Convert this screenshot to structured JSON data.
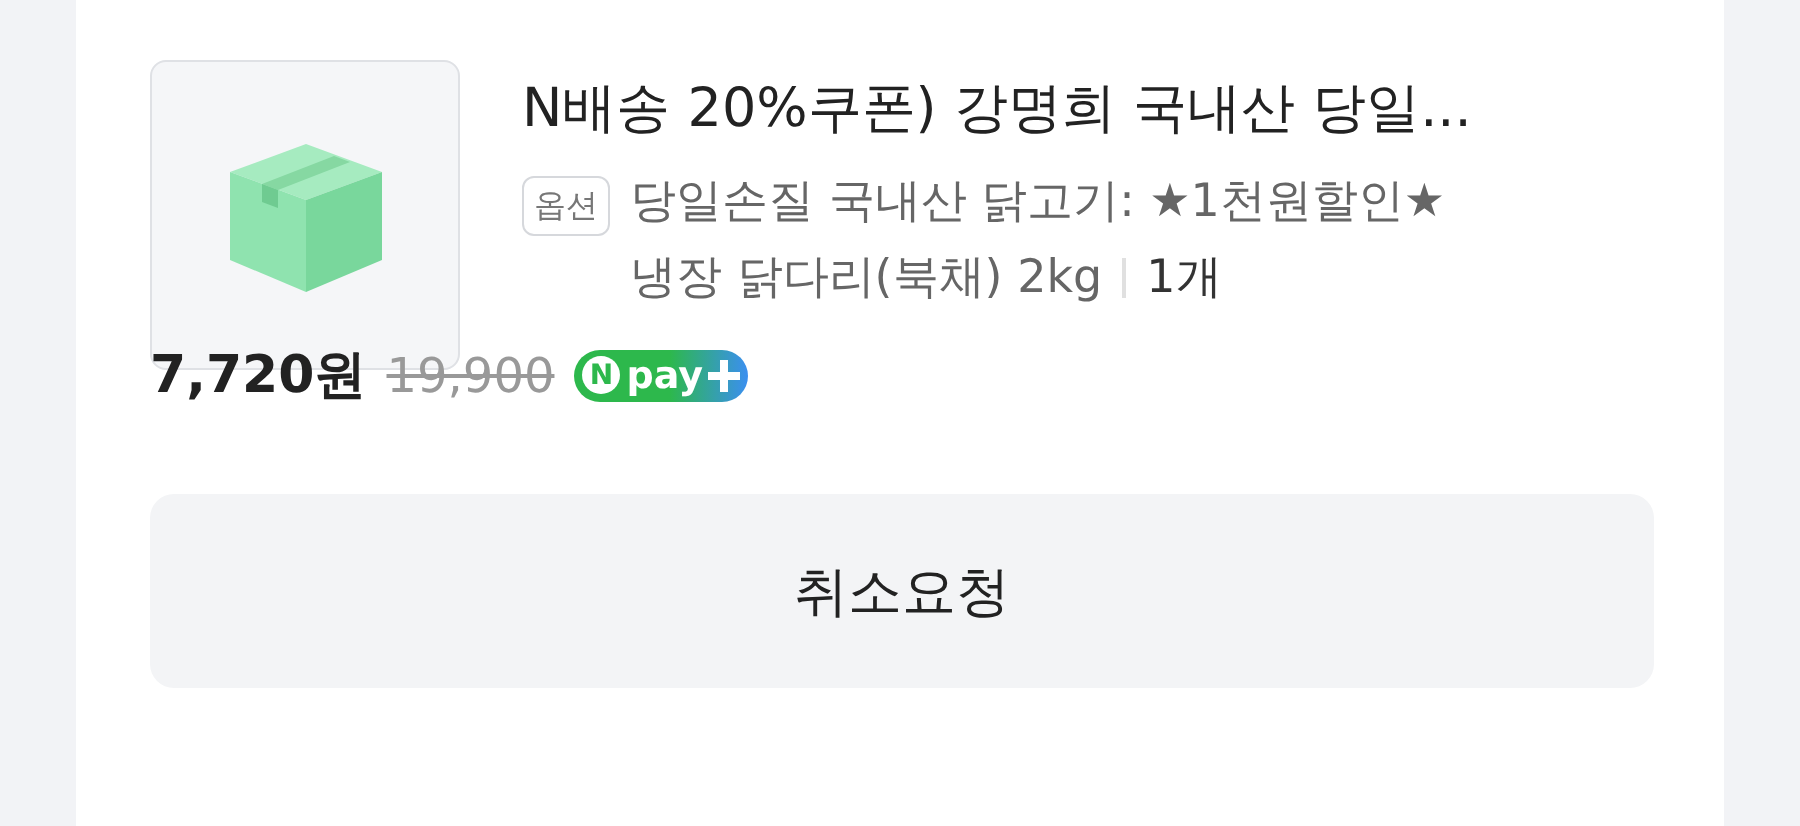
{
  "product": {
    "title": "N배송 20%쿠폰) 강명희 국내산 당일...",
    "option_tag": "옵션",
    "option_line_1": "당일손질 국내산 닭고기: ★1천원할인★",
    "option_line_2": "냉장 닭다리(북채) 2kg",
    "quantity": "1개",
    "price": "7,720원",
    "original_price": "19,900",
    "pay_badge": {
      "mark": "N",
      "label": "pay"
    }
  },
  "buttons": [
    "취소요청"
  ]
}
